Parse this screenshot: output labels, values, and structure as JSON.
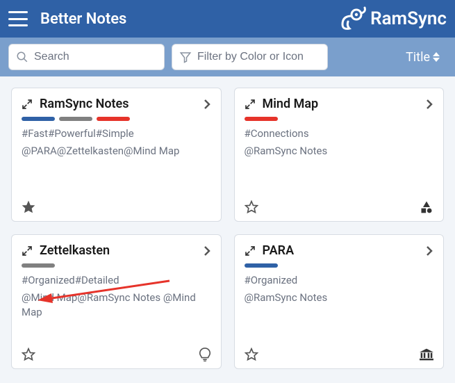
{
  "header": {
    "title": "Better Notes",
    "logo_text": "RamSync"
  },
  "toolbar": {
    "search_placeholder": "Search",
    "filter_placeholder": "Filter by Color or Icon",
    "sort_label": "Title"
  },
  "colors": {
    "blue": "#2f61a6",
    "gray": "#808080",
    "red": "#e6332a"
  },
  "cards": [
    {
      "title": "RamSync Notes",
      "bars": [
        "blue",
        "gray",
        "red"
      ],
      "tags": "#Fast#Powerful#Simple",
      "mentions": "@PARA@Zettelkasten@Mind Map",
      "starred": true,
      "foot_icon": null
    },
    {
      "title": "Mind Map",
      "bars": [
        "red"
      ],
      "tags": "#Connections",
      "mentions": "@RamSync Notes",
      "starred": false,
      "foot_icon": "shapes"
    },
    {
      "title": "Zettelkasten",
      "bars": [
        "gray"
      ],
      "tags": "#Organized#Detailed",
      "mentions": "@Mind Map@RamSync Notes @Mind Map",
      "starred": false,
      "foot_icon": "bulb"
    },
    {
      "title": "PARA",
      "bars": [
        "blue"
      ],
      "tags": "#Organized",
      "mentions": "@RamSync Notes",
      "starred": false,
      "foot_icon": "bank"
    }
  ]
}
